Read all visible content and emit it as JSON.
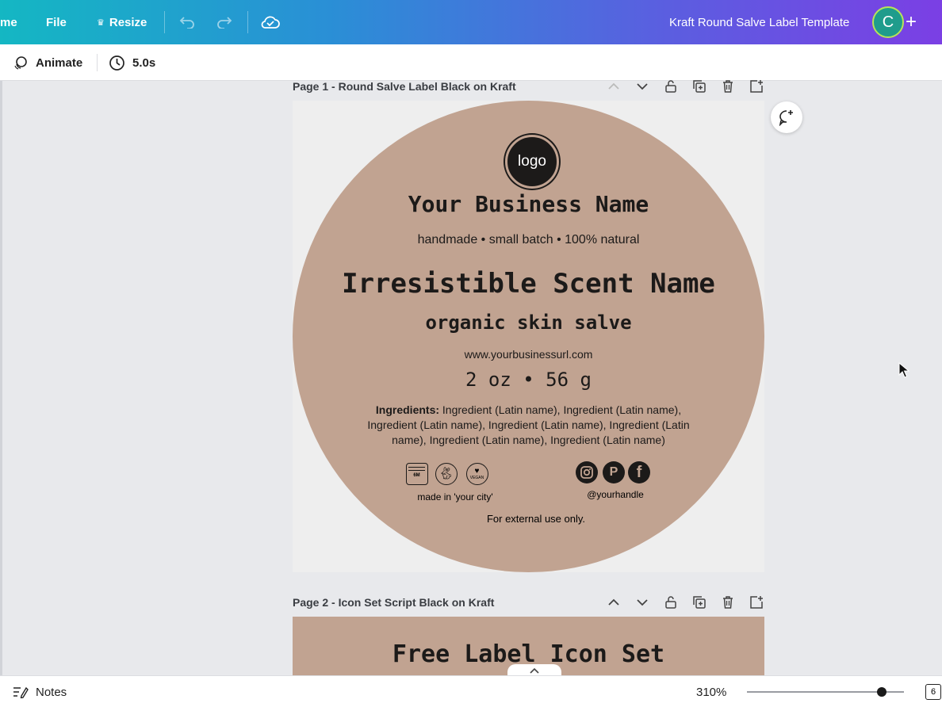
{
  "topbar": {
    "home_label": "me",
    "file_label": "File",
    "resize_label": "Resize",
    "doc_title": "Kraft Round Salve Label Template",
    "avatar_initial": "C"
  },
  "toolbar": {
    "animate_label": "Animate",
    "duration": "5.0s"
  },
  "pages": [
    {
      "header": "Page 1 - Round Salve Label Black on Kraft"
    },
    {
      "header": "Page 2 - Icon Set Script Black on Kraft"
    }
  ],
  "label": {
    "logo": "logo",
    "business_name": "Your Business Name",
    "tagline": "handmade • small batch • 100% natural",
    "scent_name": "Irresistible Scent Name",
    "product_type": "organic skin salve",
    "url": "www.yourbusinessurl.com",
    "weight": "2 oz • 56 g",
    "ingredients_label": "Ingredients:",
    "ingredients_line1": "Ingredient (Latin name), Ingredient (Latin name),",
    "ingredients_line2": "Ingredient (Latin name), Ingredient (Latin name), Ingredient (Latin",
    "ingredients_line3": "name), Ingredient (Latin name), Ingredient (Latin name)",
    "jar_text": "6M",
    "vegan_text": "VEGAN",
    "made_in": "made in 'your city'",
    "handle": "@yourhandle",
    "external_use": "For external use only."
  },
  "page2": {
    "title": "Free Label Icon Set"
  },
  "bottombar": {
    "notes_label": "Notes",
    "zoom": "310%",
    "zoom_fraction": 0.86,
    "page_count": "6"
  },
  "colors": {
    "kraft": "#c1a391",
    "ink": "#1c1a19"
  }
}
